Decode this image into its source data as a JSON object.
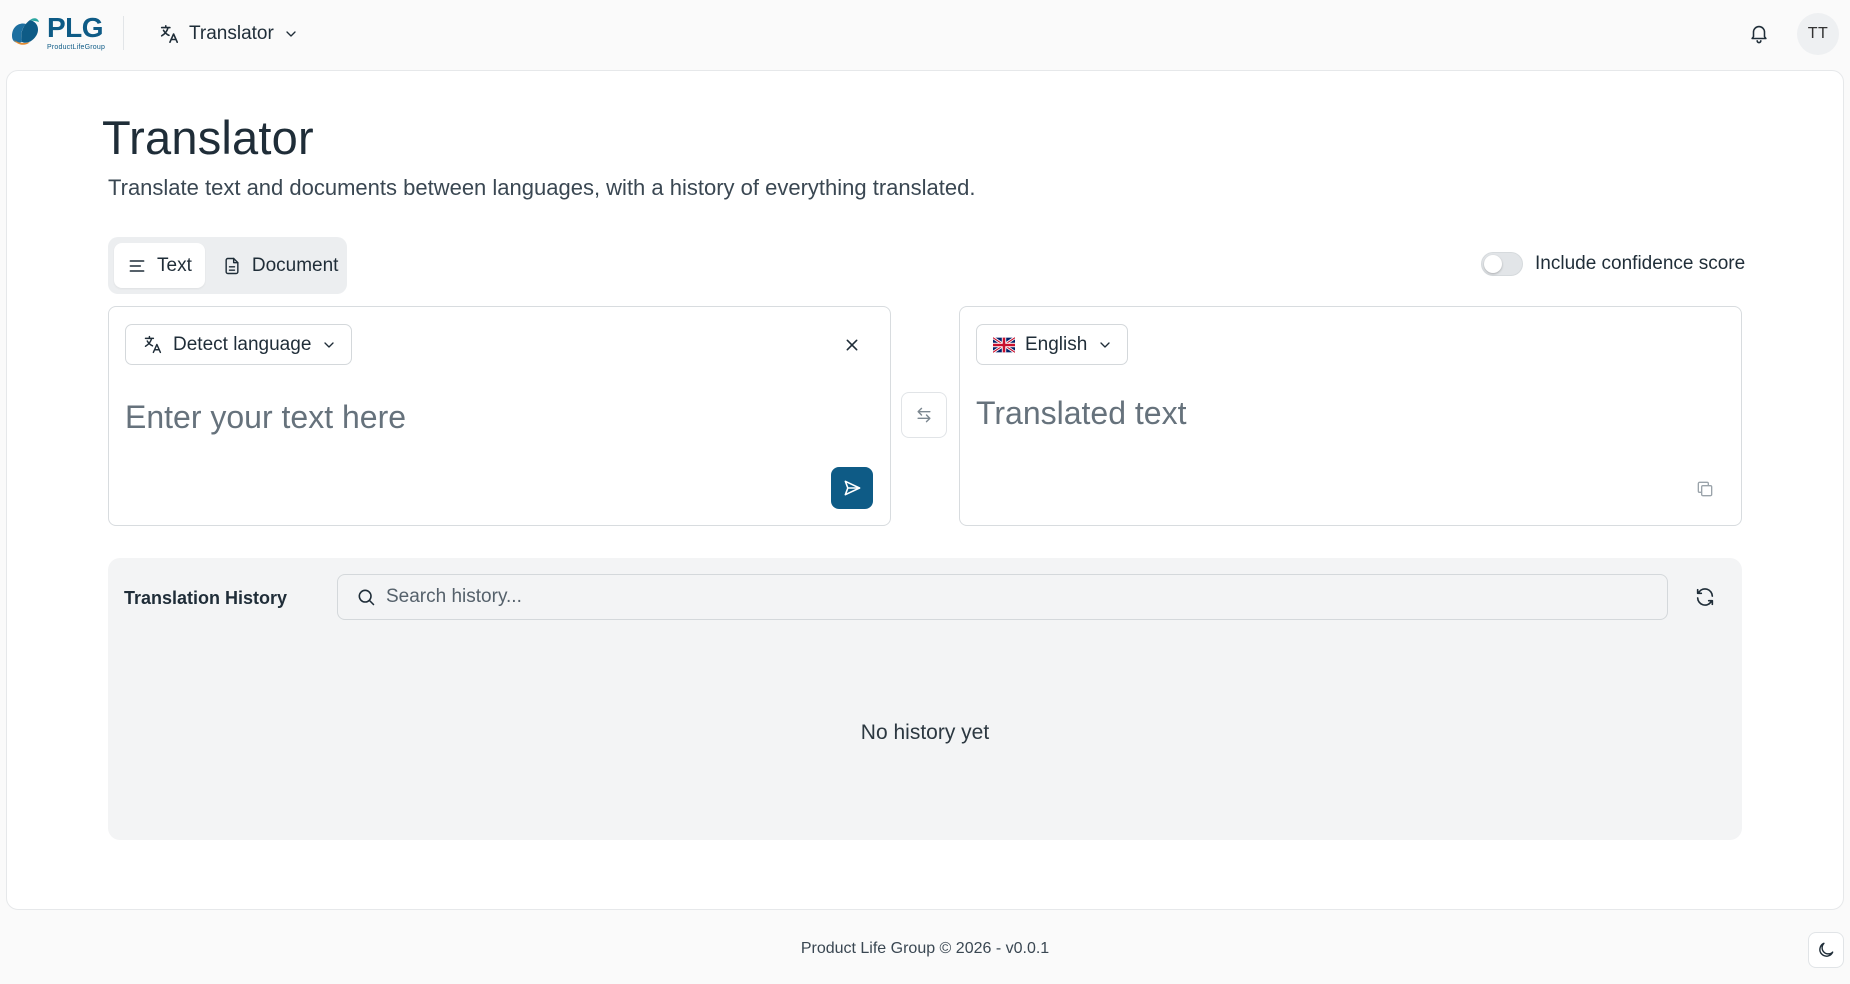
{
  "brand": {
    "name": "PLG",
    "tagline": "ProductLifeGroup"
  },
  "header": {
    "app_name": "Translator",
    "user_initials": "TT"
  },
  "page": {
    "title": "Translator",
    "subtitle": "Translate text and documents between languages, with a history of everything translated."
  },
  "mode_tabs": [
    {
      "label": "Text",
      "active": true,
      "icon": "lines-icon"
    },
    {
      "label": "Document",
      "active": false,
      "icon": "document-icon"
    }
  ],
  "options": {
    "confidence_label": "Include confidence score",
    "confidence_enabled": false
  },
  "source": {
    "language_label": "Detect language",
    "placeholder": "Enter your text here",
    "value": ""
  },
  "target": {
    "language_label": "English",
    "flag": "uk-flag-icon",
    "placeholder": "Translated text"
  },
  "history": {
    "title": "Translation History",
    "search_placeholder": "Search history...",
    "empty_message": "No history yet"
  },
  "footer": {
    "text": "Product Life Group © 2026 - v0.0.1"
  },
  "colors": {
    "primary": "#0e5b86",
    "card_bg": "#ffffff",
    "page_bg": "#fafafa",
    "history_bg": "#f3f4f5"
  }
}
